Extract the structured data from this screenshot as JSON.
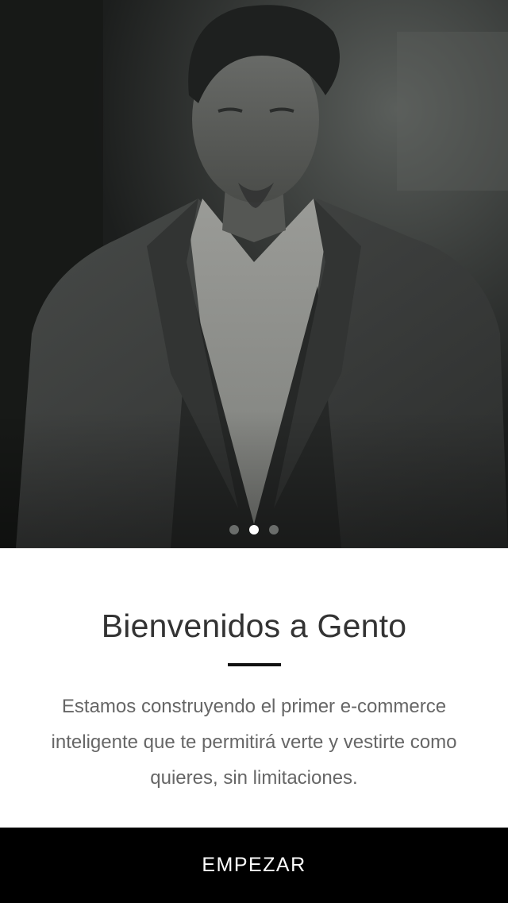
{
  "hero": {
    "image_alt": "Man in dark suit and open white shirt",
    "carousel": {
      "count": 3,
      "active_index": 1
    }
  },
  "welcome": {
    "title": "Bienvenidos a Gento",
    "body": "Estamos construyendo el primer e-commerce inteligente que te permitirá verte y vestirte como quieres, sin limitaciones."
  },
  "actions": {
    "start_label": "EMPEZAR"
  },
  "colors": {
    "button_background": "#000000",
    "button_text": "#ffffff",
    "title_text": "#333333",
    "body_text": "#666666",
    "dot_active": "#ffffff",
    "dot_inactive": "#6a6d6b"
  }
}
